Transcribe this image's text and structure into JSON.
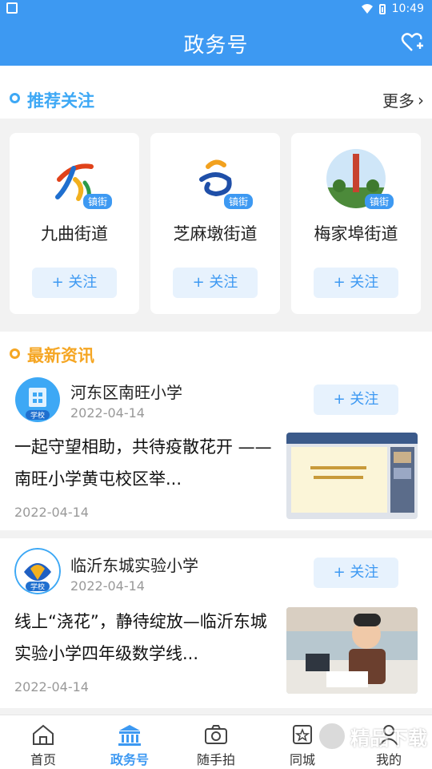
{
  "status_bar": {
    "time": "10:49"
  },
  "app_bar": {
    "title": "政务号",
    "heart_icon": "heart-plus-icon"
  },
  "recommended": {
    "title": "推荐关注",
    "more_label": "更多",
    "cards": [
      {
        "name": "九曲街道",
        "tag": "镇街",
        "follow_label": "+ 关注"
      },
      {
        "name": "芝麻墩街道",
        "tag": "镇街",
        "follow_label": "+ 关注"
      },
      {
        "name": "梅家埠街道",
        "tag": "镇街",
        "follow_label": "+ 关注"
      }
    ]
  },
  "latest": {
    "title": "最新资讯",
    "items": [
      {
        "source": "河东区南旺小学",
        "source_date": "2022-04-14",
        "badge": "学校",
        "follow_label": "+ 关注",
        "headline": "一起守望相助，共待疫散花开 ——南旺小学黄屯校区举...",
        "date": "2022-04-14"
      },
      {
        "source": "临沂东城实验小学",
        "source_date": "2022-04-14",
        "badge": "学校",
        "follow_label": "+ 关注",
        "headline": "线上“浇花”，静待绽放—临沂东城实验小学四年级数学线...",
        "date": "2022-04-14"
      }
    ]
  },
  "tabs": [
    {
      "label": "首页",
      "icon": "home-icon",
      "active": false
    },
    {
      "label": "政务号",
      "icon": "government-building-icon",
      "active": true
    },
    {
      "label": "随手拍",
      "icon": "camera-icon",
      "active": false
    },
    {
      "label": "同城",
      "icon": "city-icon",
      "active": false
    },
    {
      "label": "我的",
      "icon": "person-icon",
      "active": false
    }
  ],
  "watermark": {
    "text": "精品下载"
  },
  "colors": {
    "primary": "#3d99f2",
    "follow_bg": "#e7f2fd",
    "ring_blue": "#3da8f5",
    "ring_orange": "#f5a623"
  }
}
